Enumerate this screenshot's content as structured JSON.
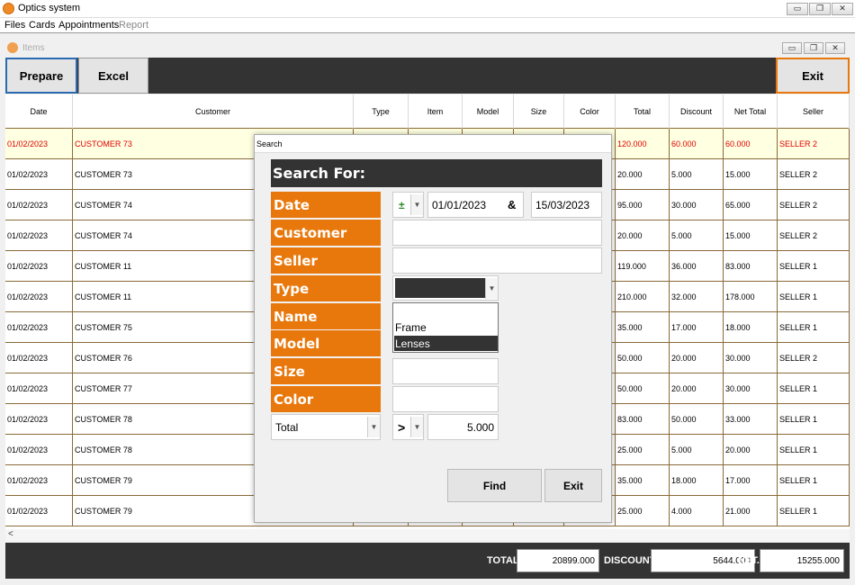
{
  "app": {
    "title": "Optics system",
    "child_title": "Items"
  },
  "window_buttons": {
    "minimize": "▭",
    "restore": "❐",
    "close": "✕"
  },
  "menu": [
    "Files",
    "Cards",
    "Appointments",
    "Report"
  ],
  "toolbar": {
    "prepare": "Prepare",
    "excel": "Excel",
    "exit": "Exit"
  },
  "colors": {
    "accent_orange": "#e8780c",
    "dark": "#333333",
    "selected_row_bg": "#ffffe1",
    "selected_row_text": "#e00000"
  },
  "grid": {
    "columns": [
      "Date",
      "Customer",
      "Type",
      "Item",
      "Model",
      "Size",
      "Color",
      "Total",
      "Discount",
      "Net Total",
      "Seller"
    ],
    "rows": [
      {
        "date": "01/02/2023",
        "customer": "CUSTOMER 73",
        "total": "120.000",
        "discount": "60.000",
        "net": "60.000",
        "seller": "SELLER 2",
        "selected": true
      },
      {
        "date": "01/02/2023",
        "customer": "CUSTOMER 73",
        "total": "20.000",
        "discount": "5.000",
        "net": "15.000",
        "seller": "SELLER 2"
      },
      {
        "date": "01/02/2023",
        "customer": "CUSTOMER 74",
        "total": "95.000",
        "discount": "30.000",
        "net": "65.000",
        "seller": "SELLER 2"
      },
      {
        "date": "01/02/2023",
        "customer": "CUSTOMER 74",
        "total": "20.000",
        "discount": "5.000",
        "net": "15.000",
        "seller": "SELLER 2"
      },
      {
        "date": "01/02/2023",
        "customer": "CUSTOMER 11",
        "total": "119.000",
        "discount": "36.000",
        "net": "83.000",
        "seller": "SELLER 1"
      },
      {
        "date": "01/02/2023",
        "customer": "CUSTOMER 11",
        "total": "210.000",
        "discount": "32.000",
        "net": "178.000",
        "seller": "SELLER 1"
      },
      {
        "date": "01/02/2023",
        "customer": "CUSTOMER 75",
        "total": "35.000",
        "discount": "17.000",
        "net": "18.000",
        "seller": "SELLER 1"
      },
      {
        "date": "01/02/2023",
        "customer": "CUSTOMER 76",
        "total": "50.000",
        "discount": "20.000",
        "net": "30.000",
        "seller": "SELLER 2"
      },
      {
        "date": "01/02/2023",
        "customer": "CUSTOMER 77",
        "total": "50.000",
        "discount": "20.000",
        "net": "30.000",
        "seller": "SELLER 1"
      },
      {
        "date": "01/02/2023",
        "customer": "CUSTOMER 78",
        "total": "83.000",
        "discount": "50.000",
        "net": "33.000",
        "seller": "SELLER 1"
      },
      {
        "date": "01/02/2023",
        "customer": "CUSTOMER 78",
        "total": "25.000",
        "discount": "5.000",
        "net": "20.000",
        "seller": "SELLER 1"
      },
      {
        "date": "01/02/2023",
        "customer": "CUSTOMER 79",
        "total": "35.000",
        "discount": "18.000",
        "net": "17.000",
        "seller": "SELLER 1"
      },
      {
        "date": "01/02/2023",
        "customer": "CUSTOMER 79",
        "total": "25.000",
        "discount": "4.000",
        "net": "21.000",
        "seller": "SELLER 1"
      }
    ]
  },
  "scroll_left": "<",
  "footer": {
    "total_label": "TOTAL",
    "total_value": "20899.000",
    "discount_label": "DISCOUNT",
    "discount_value": "5644.000",
    "net_label": "NET.",
    "net_value": "15255.000"
  },
  "dialog": {
    "title": "Search",
    "header": "Search For:",
    "labels": {
      "date": "Date",
      "customer": "Customer",
      "seller": "Seller",
      "type": "Type",
      "name": "Name",
      "model": "Model",
      "size": "Size",
      "color": "Color"
    },
    "date_operator": "±",
    "date_from": "01/01/2023",
    "date_and": "&",
    "date_to": "15/03/2023",
    "type_options": [
      "Frame",
      "Lenses"
    ],
    "type_highlighted": "Lenses",
    "amount_field": "Total",
    "amount_operator": ">",
    "amount_value": "5.000",
    "find": "Find",
    "exit": "Exit"
  }
}
